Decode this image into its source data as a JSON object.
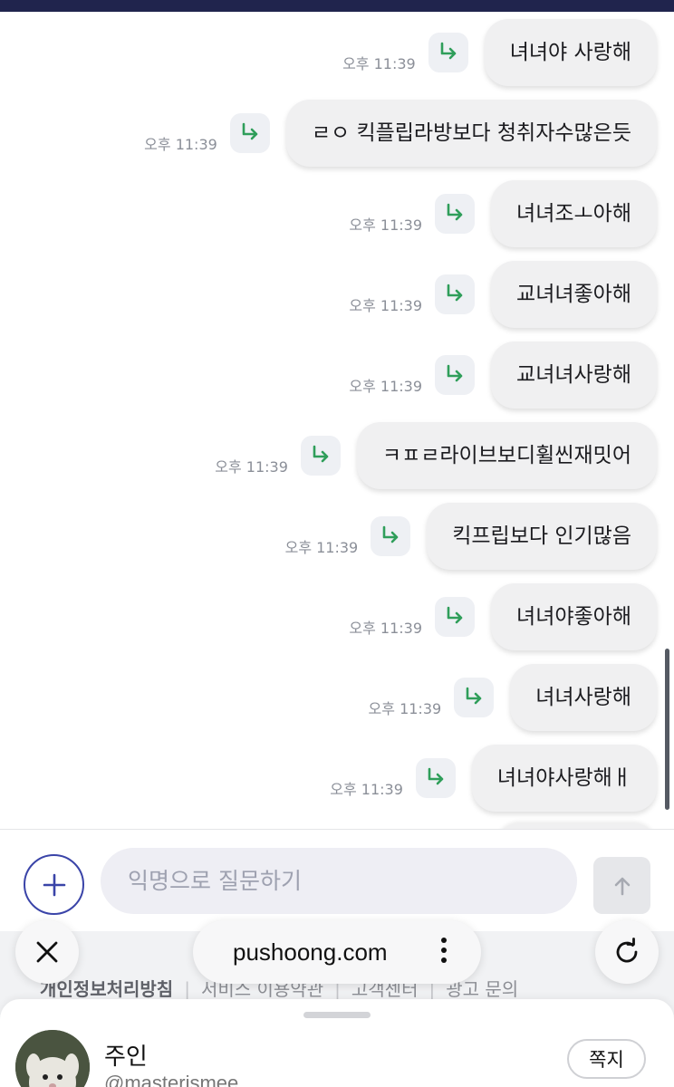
{
  "messages": [
    {
      "text": "녀녀야 사랑해",
      "time": "오후 11:39"
    },
    {
      "text": "ㄹㅇ 킥플립라방보다 청취자수많은듯",
      "time": "오후 11:39"
    },
    {
      "text": "녀녀조ㅗ아해",
      "time": "오후 11:39"
    },
    {
      "text": "교녀녀좋아해",
      "time": "오후 11:39"
    },
    {
      "text": "교녀녀사랑해",
      "time": "오후 11:39"
    },
    {
      "text": "ㅋㅍㄹ라이브보디휠씬재밋어",
      "time": "오후 11:39"
    },
    {
      "text": "킥프립보다 인기많음",
      "time": "오후 11:39"
    },
    {
      "text": "녀녀야좋아해",
      "time": "오후 11:39"
    },
    {
      "text": "녀녀사랑해",
      "time": "오후 11:39"
    },
    {
      "text": "녀녀야사랑해ㅐ",
      "time": "오후 11:39"
    }
  ],
  "composer": {
    "placeholder": "익명으로 질문하기"
  },
  "footer": {
    "links": [
      "개인정보처리방침",
      "서비스 이용약관",
      "고객센터",
      "광고 문의"
    ]
  },
  "browser": {
    "url": "pushoong.com"
  },
  "profile": {
    "name": "주인",
    "handle": "@masterismee",
    "dm_label": "쪽지"
  },
  "colors": {
    "top_bar": "#20244d",
    "accent": "#3a44a8",
    "reply_arrow": "#2f9e5a",
    "bubble": "#f0f0f1"
  },
  "icons": {
    "reply": "reply-arrow-icon",
    "plus": "plus-icon",
    "send": "arrow-up-icon",
    "close": "close-icon",
    "more": "more-vertical-icon",
    "reload": "reload-icon"
  }
}
